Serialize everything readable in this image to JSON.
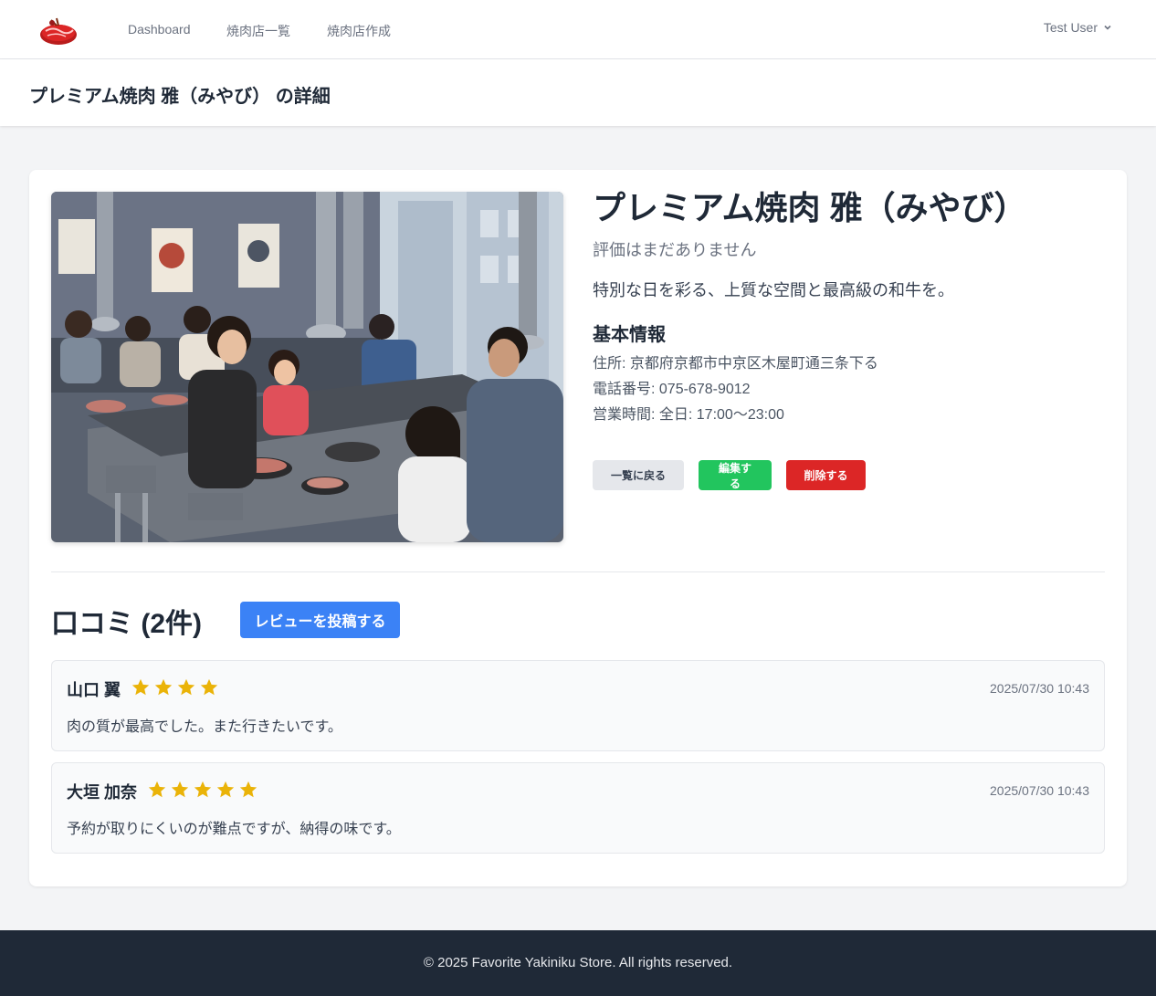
{
  "nav": {
    "logo_icon": "meat-logo-icon",
    "links": [
      {
        "label": "Dashboard"
      },
      {
        "label": "焼肉店一覧"
      },
      {
        "label": "焼肉店作成"
      }
    ],
    "user_name": "Test User"
  },
  "header": {
    "title": "プレミアム焼肉 雅（みやび） の詳細"
  },
  "store": {
    "name": "プレミアム焼肉 雅（みやび）",
    "rating_text": "評価はまだありません",
    "description": "特別な日を彩る、上質な空間と最高級の和牛を。",
    "basic_info_heading": "基本情報",
    "address": "住所: 京都府京都市中京区木屋町通三条下る",
    "phone": "電話番号: 075-678-9012",
    "hours": "営業時間: 全日: 17:00〜23:00"
  },
  "actions": {
    "back_label": "一覧に戻る",
    "edit_label": "編集する",
    "delete_label": "削除する"
  },
  "reviews": {
    "heading": "口コミ (2件)",
    "post_label": "レビューを投稿する",
    "items": [
      {
        "name": "山口 翼",
        "stars": 4,
        "date": "2025/07/30 10:43",
        "text": "肉の質が最高でした。また行きたいです。"
      },
      {
        "name": "大垣 加奈",
        "stars": 5,
        "date": "2025/07/30 10:43",
        "text": "予約が取りにくいのが難点ですが、納得の味です。"
      }
    ]
  },
  "colors": {
    "star": "#eab308",
    "primary": "#3b82f6",
    "success": "#22c55e",
    "danger": "#dc2626",
    "footer_bg": "#1f2937"
  },
  "footer": {
    "text": "© 2025 Favorite Yakiniku Store. All rights reserved."
  }
}
